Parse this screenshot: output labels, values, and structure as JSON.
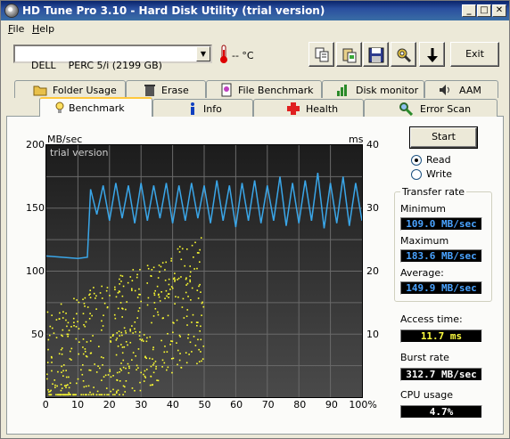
{
  "window": {
    "title": "HD Tune Pro 3.10 - Hard Disk Utility (trial version)"
  },
  "title_buttons": {
    "minimize": "_",
    "maximize": "□",
    "close": "✕"
  },
  "menu": {
    "items": [
      {
        "key": "F",
        "rest": "ile"
      },
      {
        "key": "H",
        "rest": "elp"
      }
    ]
  },
  "toolbar": {
    "drive": "DELL    PERC 5/i (2199 GB)",
    "temperature": "-- °C",
    "exit_label": "Exit"
  },
  "tabs_back": [
    {
      "label": "Folder Usage",
      "icon": "folder-icon"
    },
    {
      "label": "Erase",
      "icon": "trash-icon"
    },
    {
      "label": "File Benchmark",
      "icon": "file-benchmark-icon"
    },
    {
      "label": "Disk monitor",
      "icon": "chart-icon"
    },
    {
      "label": "AAM",
      "icon": "speaker-icon"
    }
  ],
  "tabs_front": [
    {
      "label": "Benchmark",
      "icon": "lightbulb-icon"
    },
    {
      "label": "Info",
      "icon": "info-icon"
    },
    {
      "label": "Health",
      "icon": "health-cross-icon"
    },
    {
      "label": "Error Scan",
      "icon": "magnifier-icon"
    }
  ],
  "graph": {
    "left_unit": "MB/sec",
    "right_unit": "ms",
    "watermark": "trial version",
    "y_left_ticks": [
      "200",
      "150",
      "100",
      "50"
    ],
    "y_right_ticks": [
      "40",
      "30",
      "20",
      "10"
    ],
    "x_ticks": [
      "0",
      "10",
      "20",
      "30",
      "40",
      "50",
      "60",
      "70",
      "80",
      "90",
      "100%"
    ],
    "colors": {
      "transfer_line": "#3aa6e8",
      "access_points": "#ffff30"
    }
  },
  "chart_data": {
    "type": "line",
    "x_label": "",
    "x_range": [
      0,
      100
    ],
    "y_left_range": [
      0,
      200
    ],
    "y_right_range": [
      0,
      40
    ],
    "series": [
      {
        "type": "line",
        "axis": "left",
        "values_x": [
          0,
          5,
          10,
          13,
          14,
          16,
          18,
          20,
          22,
          24,
          26,
          28,
          30,
          32,
          34,
          36,
          38,
          40,
          42,
          44,
          46,
          48,
          50,
          52,
          54,
          56,
          58,
          60,
          62,
          64,
          66,
          68,
          70,
          72,
          74,
          76,
          78,
          80,
          82,
          84,
          86,
          88,
          90,
          92,
          94,
          96,
          98,
          100
        ],
        "values_y": [
          112,
          111,
          110,
          111,
          165,
          145,
          168,
          140,
          170,
          142,
          168,
          138,
          170,
          140,
          168,
          142,
          170,
          138,
          168,
          140,
          170,
          142,
          168,
          138,
          172,
          140,
          168,
          135,
          170,
          140,
          172,
          138,
          168,
          140,
          175,
          136,
          170,
          138,
          172,
          140,
          178,
          134,
          170,
          138,
          175,
          136,
          170,
          140
        ]
      },
      {
        "type": "scatter",
        "axis": "right",
        "note_range_x": [
          0,
          50
        ],
        "note_range_y": [
          0,
          32
        ]
      }
    ]
  },
  "controls": {
    "start_label": "Start",
    "read_label": "Read",
    "write_label": "Write",
    "mode": "read"
  },
  "transfer": {
    "group_title": "Transfer rate",
    "min_label": "Minimum",
    "min_value": "109.0 MB/sec",
    "max_label": "Maximum",
    "max_value": "183.6 MB/sec",
    "avg_label": "Average:",
    "avg_value": "149.9 MB/sec"
  },
  "stats": {
    "access_label": "Access time:",
    "access_value": "11.7 ms",
    "burst_label": "Burst rate",
    "burst_value": "312.7 MB/sec",
    "cpu_label": "CPU usage",
    "cpu_value": "4.7%"
  }
}
